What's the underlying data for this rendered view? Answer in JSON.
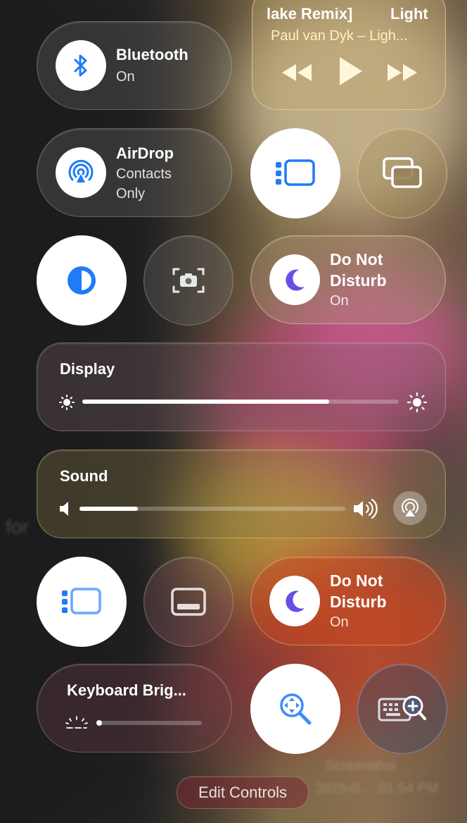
{
  "now_playing": {
    "track": "lake Remix]",
    "track_tail": "Light",
    "artist": "Paul van Dyk – Ligh..."
  },
  "bluetooth": {
    "title": "Bluetooth",
    "status": "On"
  },
  "airdrop": {
    "title": "AirDrop",
    "status_line1": "Contacts",
    "status_line2": "Only"
  },
  "focus_top": {
    "title_line1": "Do Not",
    "title_line2": "Disturb",
    "status": "On"
  },
  "display": {
    "label": "Display",
    "brightness": 0.78
  },
  "sound": {
    "label": "Sound",
    "volume": 0.22
  },
  "focus_bottom": {
    "title_line1": "Do Not",
    "title_line2": "Disturb",
    "status": "On"
  },
  "keyboard": {
    "label": "Keyboard Brig...",
    "level": 0.02
  },
  "edit_controls": "Edit Controls",
  "background_text": {
    "left": "for",
    "right_line1": "Screenshot",
    "right_line2": "2025-0... .01.54 PM"
  },
  "colors": {
    "accent_blue": "#1f7bf6",
    "moon_purple": "#6a4de8"
  }
}
